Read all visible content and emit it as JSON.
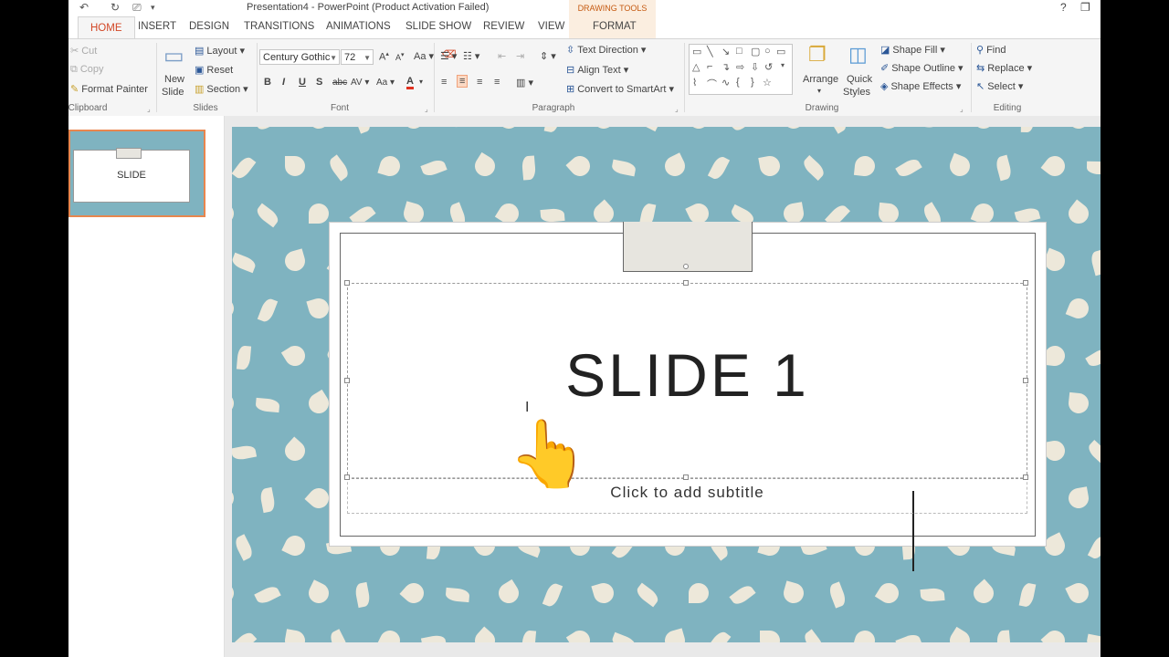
{
  "window": {
    "title": "Presentation4 - PowerPoint (Product Activation Failed)",
    "contextual_label": "DRAWING TOOLS",
    "help_glyph": "?",
    "restore_glyph": "❐"
  },
  "tabs": [
    "HOME",
    "INSERT",
    "DESIGN",
    "TRANSITIONS",
    "ANIMATIONS",
    "SLIDE SHOW",
    "REVIEW",
    "VIEW",
    "FORMAT"
  ],
  "ribbon": {
    "clipboard": {
      "cut": "Cut",
      "copy": "Copy",
      "format_painter": "Format Painter",
      "label": "Clipboard"
    },
    "slides": {
      "new_slide_1": "New",
      "new_slide_2": "Slide",
      "layout": "Layout",
      "reset": "Reset",
      "section": "Section",
      "label": "Slides"
    },
    "font": {
      "family": "Century Gothic",
      "size": "72",
      "grow": "A",
      "shrink": "A",
      "case": "Aa",
      "bold": "B",
      "italic": "I",
      "underline": "U",
      "shadow": "S",
      "strike": "abc",
      "spacing": "AV",
      "color": "A",
      "label": "Font"
    },
    "paragraph": {
      "text_direction": "Text Direction",
      "align_text": "Align Text",
      "convert_smartart": "Convert to SmartArt",
      "label": "Paragraph"
    },
    "drawing": {
      "arrange": "Arrange",
      "quick_styles_1": "Quick",
      "quick_styles_2": "Styles",
      "shape_fill": "Shape Fill",
      "shape_outline": "Shape Outline",
      "shape_effects": "Shape Effects",
      "label": "Drawing"
    },
    "editing": {
      "find": "Find",
      "replace": "Replace",
      "select": "Select",
      "label": "Editing"
    }
  },
  "thumbnail": {
    "text": "SLIDE"
  },
  "slide": {
    "title": "SLIDE 1",
    "subtitle_placeholder": "Click to add subtitle"
  },
  "colors": {
    "accent": "#d24726",
    "slide_bg": "#7fb3c0",
    "pattern": "#ede8da"
  }
}
